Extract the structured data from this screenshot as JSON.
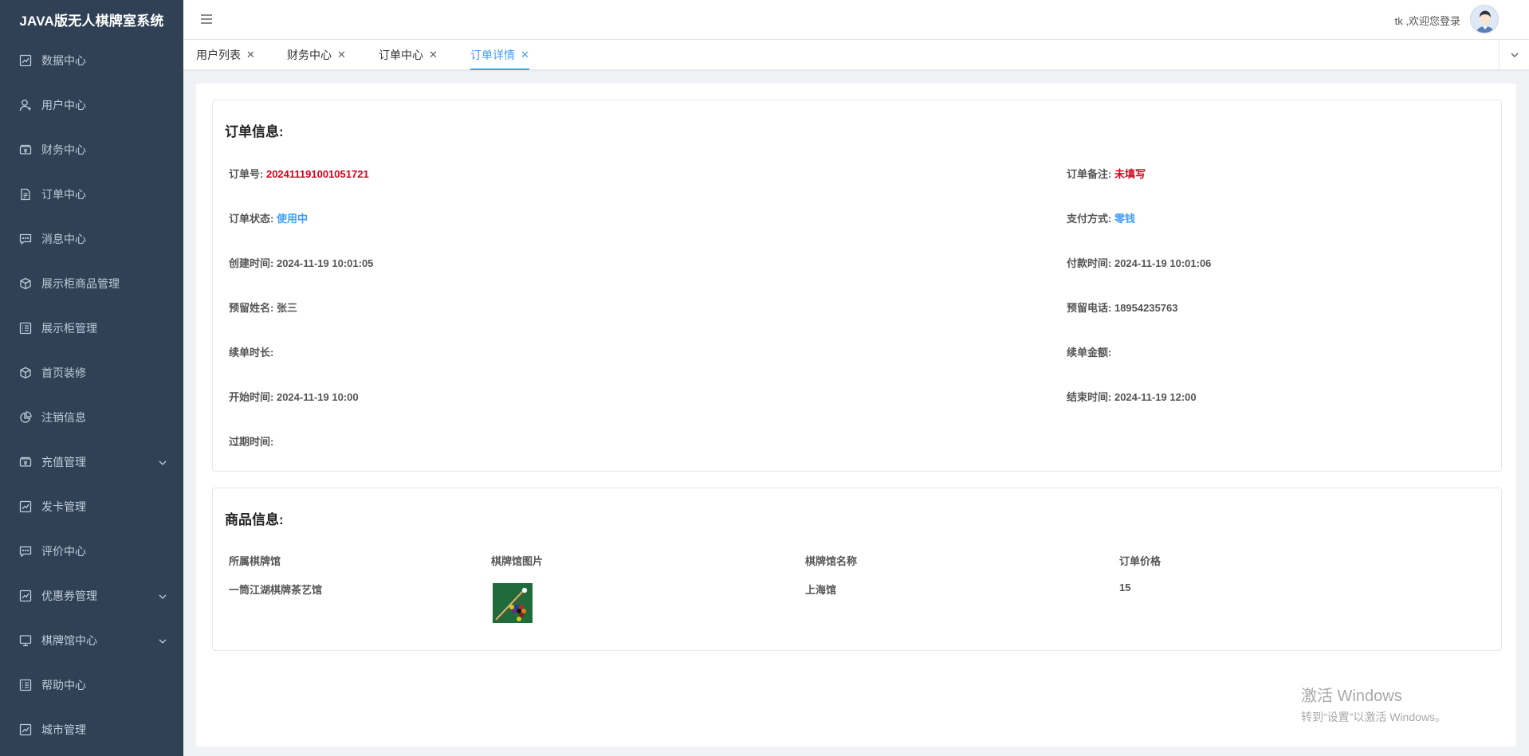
{
  "app": {
    "title": "JAVA版无人棋牌室系统"
  },
  "sidebar": {
    "items": [
      {
        "label": "数据中心",
        "icon": "chart-icon",
        "expandable": false
      },
      {
        "label": "用户中心",
        "icon": "user-icon",
        "expandable": false
      },
      {
        "label": "财务中心",
        "icon": "money-icon",
        "expandable": false
      },
      {
        "label": "订单中心",
        "icon": "document-icon",
        "expandable": false
      },
      {
        "label": "消息中心",
        "icon": "message-icon",
        "expandable": false
      },
      {
        "label": "展示柜商品管理",
        "icon": "box-icon",
        "expandable": false
      },
      {
        "label": "展示柜管理",
        "icon": "list-icon",
        "expandable": false
      },
      {
        "label": "首页装修",
        "icon": "box-icon",
        "expandable": false
      },
      {
        "label": "注销信息",
        "icon": "pie-icon",
        "expandable": false
      },
      {
        "label": "充值管理",
        "icon": "money-icon",
        "expandable": true
      },
      {
        "label": "发卡管理",
        "icon": "chart-icon",
        "expandable": false
      },
      {
        "label": "评价中心",
        "icon": "message-icon",
        "expandable": false
      },
      {
        "label": "优惠券管理",
        "icon": "chart-icon",
        "expandable": true
      },
      {
        "label": "棋牌馆中心",
        "icon": "monitor-icon",
        "expandable": true
      },
      {
        "label": "帮助中心",
        "icon": "list-icon",
        "expandable": false
      },
      {
        "label": "城市管理",
        "icon": "chart-icon",
        "expandable": false
      }
    ]
  },
  "header": {
    "welcome": "tk ,欢迎您登录"
  },
  "tabs": [
    {
      "label": "用户列表",
      "active": false
    },
    {
      "label": "财务中心",
      "active": false
    },
    {
      "label": "订单中心",
      "active": false
    },
    {
      "label": "订单详情",
      "active": true
    }
  ],
  "order_info": {
    "title": "订单信息:",
    "order_no_label": "订单号:",
    "order_no": "202411191001051721",
    "remark_label": "订单备注:",
    "remark": "未填写",
    "status_label": "订单状态:",
    "status": "使用中",
    "payment_label": "支付方式:",
    "payment": "零钱",
    "created_label": "创建时间:",
    "created": "2024-11-19 10:01:05",
    "paid_label": "付款时间:",
    "paid": "2024-11-19 10:01:06",
    "name_label": "预留姓名:",
    "name": "张三",
    "phone_label": "预留电话:",
    "phone": "18954235763",
    "renew_duration_label": "续单时长:",
    "renew_duration": "",
    "renew_amount_label": "续单金额:",
    "renew_amount": "",
    "start_label": "开始时间:",
    "start": "2024-11-19 10:00",
    "end_label": "结束时间:",
    "end": "2024-11-19 12:00",
    "expire_label": "过期时间:",
    "expire": ""
  },
  "goods_info": {
    "title": "商品信息:",
    "columns": [
      "所属棋牌馆",
      "棋牌馆图片",
      "棋牌馆名称",
      "订单价格"
    ],
    "row": {
      "hall": "一筒江湖棋牌茶艺馆",
      "image": "billiards-image",
      "name": "上海馆",
      "price": "15"
    }
  },
  "watermark": {
    "title": "激活 Windows",
    "subtitle": "转到“设置”以激活 Windows。"
  },
  "colors": {
    "sidebar_bg": "#304156",
    "accent": "#409eff",
    "danger": "#d9001b"
  }
}
